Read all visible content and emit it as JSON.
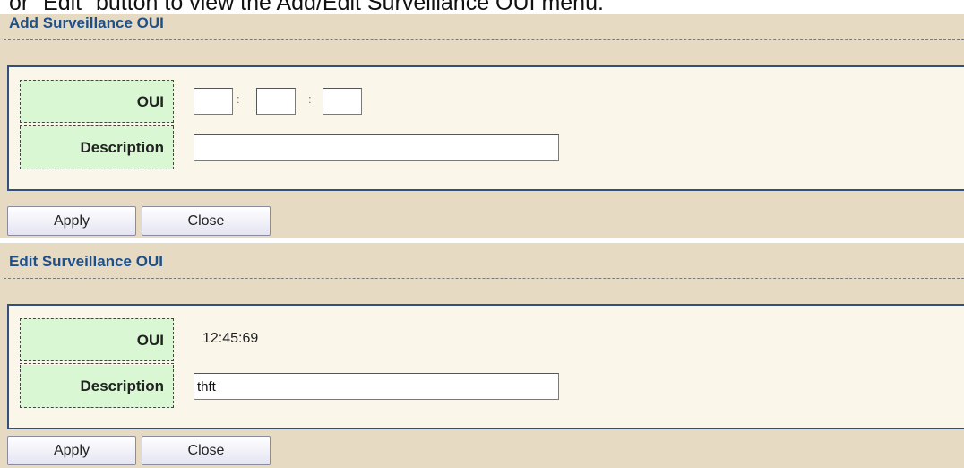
{
  "document": {
    "text": "or \"Edit\" button to view the Add/Edit Surveillance OUI menu."
  },
  "add_panel": {
    "title": "Add Surveillance OUI",
    "oui_label": "OUI",
    "oui_fields": [
      "",
      "",
      ""
    ],
    "oui_separator": ":",
    "description_label": "Description",
    "description_value": "",
    "apply_label": "Apply",
    "close_label": "Close"
  },
  "edit_panel": {
    "title": "Edit Surveillance OUI",
    "oui_label": "OUI",
    "oui_value": "12:45:69",
    "description_label": "Description",
    "description_value": "thft",
    "apply_label": "Apply",
    "close_label": "Close"
  },
  "colors": {
    "panel_bg": "#e6dac2",
    "form_bg": "#fbf6ea",
    "label_bg": "#d8f7d2",
    "title": "#1d4f8a",
    "border": "#34507a"
  }
}
